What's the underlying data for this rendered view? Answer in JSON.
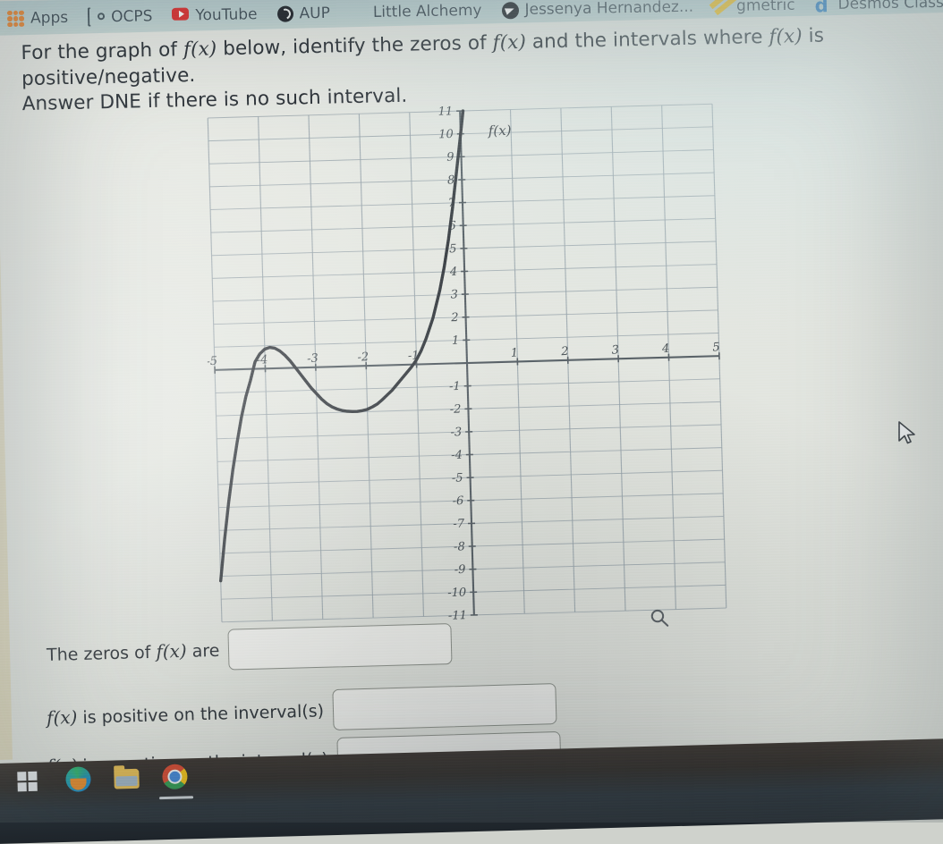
{
  "browser": {
    "bookmarks": [
      {
        "label": "Apps",
        "icon": "apps-grid-icon"
      },
      {
        "label": "OCPS",
        "icon": "gear-icon"
      },
      {
        "label": "YouTube",
        "icon": "youtube-icon"
      },
      {
        "label": "AUP",
        "icon": "globe-icon"
      },
      {
        "label": "Little Alchemy",
        "icon": "alchemy-flask-icon"
      },
      {
        "label": "Jessenya Hernandez...",
        "icon": "paper-plane-icon"
      },
      {
        "label": "gmetric",
        "icon": "gmetric-icon"
      },
      {
        "label": "Desmos Class",
        "icon": "desmos-d-icon"
      }
    ]
  },
  "question": {
    "line1_a": "For the graph of ",
    "line1_fx1": "f(x)",
    "line1_b": " below, identify the zeros of ",
    "line1_fx2": "f(x)",
    "line1_c": " and the intervals where ",
    "line1_fx3": "f(x)",
    "line1_d": " is positive/negative.",
    "line2": "Answer DNE if there is no such interval."
  },
  "answers": {
    "row1_pre": "The zeros of ",
    "row1_fx": "f(x)",
    "row1_post": " are",
    "row1_value": "",
    "row2_fx": "f(x)",
    "row2_post": " is positive on the inverval(s)",
    "row2_value": "",
    "row3_fx": "f(x)",
    "row3_post": " is negative on the interval(s)",
    "row3_value": ""
  },
  "taskbar": {
    "items": [
      {
        "name": "start-button",
        "icon": "windows-logo-icon"
      },
      {
        "name": "edge-button",
        "icon": "edge-icon"
      },
      {
        "name": "file-explorer-button",
        "icon": "folder-icon"
      },
      {
        "name": "chrome-button",
        "icon": "chrome-icon",
        "active": true
      }
    ]
  },
  "chart_data": {
    "type": "line",
    "title": "",
    "xlabel": "",
    "ylabel": "",
    "curve_label": "f(x)",
    "xlim": [
      -5,
      5
    ],
    "ylim": [
      -11,
      11
    ],
    "grid": true,
    "x_ticks": [
      -5,
      -4,
      -3,
      -2,
      -1,
      1,
      2,
      3,
      4,
      5
    ],
    "y_ticks": [
      -11,
      -10,
      -9,
      -8,
      -7,
      -6,
      -5,
      -4,
      -3,
      -2,
      -1,
      1,
      2,
      3,
      4,
      5,
      6,
      7,
      8,
      9,
      10,
      11
    ],
    "x_tick_labels": [
      "-5",
      "-4",
      "-3",
      "-2",
      "-1",
      "1",
      "2",
      "3",
      "4",
      "5"
    ],
    "y_tick_labels": [
      "-11",
      "-10",
      "-9",
      "-8",
      "-7",
      "-6",
      "-5",
      "-4",
      "-3",
      "-2",
      "-1",
      "1",
      "2",
      "3",
      "4",
      "5",
      "6",
      "7",
      "8",
      "9",
      "10",
      "11"
    ],
    "zeros": [
      -3.4,
      -0.65
    ],
    "local_max": [
      -4.2,
      0.9
    ],
    "local_min": [
      -2.2,
      -1.9
    ],
    "series": [
      {
        "name": "f(x)",
        "points": [
          [
            -5.0,
            -9.2
          ],
          [
            -4.9,
            -7.4
          ],
          [
            -4.8,
            -5.8
          ],
          [
            -4.7,
            -4.4
          ],
          [
            -4.6,
            -3.2
          ],
          [
            -4.5,
            -2.1
          ],
          [
            -4.4,
            -1.2
          ],
          [
            -4.3,
            -0.5
          ],
          [
            -4.2,
            0.3
          ],
          [
            -4.1,
            0.65
          ],
          [
            -4.0,
            0.85
          ],
          [
            -3.9,
            0.92
          ],
          [
            -3.8,
            0.88
          ],
          [
            -3.7,
            0.75
          ],
          [
            -3.6,
            0.55
          ],
          [
            -3.5,
            0.3
          ],
          [
            -3.4,
            0.0
          ],
          [
            -3.3,
            -0.3
          ],
          [
            -3.2,
            -0.6
          ],
          [
            -3.1,
            -0.9
          ],
          [
            -3.0,
            -1.15
          ],
          [
            -2.9,
            -1.4
          ],
          [
            -2.8,
            -1.6
          ],
          [
            -2.7,
            -1.75
          ],
          [
            -2.6,
            -1.85
          ],
          [
            -2.5,
            -1.92
          ],
          [
            -2.4,
            -1.96
          ],
          [
            -2.3,
            -1.98
          ],
          [
            -2.2,
            -1.98
          ],
          [
            -2.1,
            -1.95
          ],
          [
            -2.0,
            -1.9
          ],
          [
            -1.9,
            -1.8
          ],
          [
            -1.8,
            -1.68
          ],
          [
            -1.7,
            -1.5
          ],
          [
            -1.6,
            -1.3
          ],
          [
            -1.5,
            -1.1
          ],
          [
            -1.4,
            -0.85
          ],
          [
            -1.3,
            -0.6
          ],
          [
            -1.2,
            -0.35
          ],
          [
            -1.1,
            -0.1
          ],
          [
            -1.0,
            0.2
          ],
          [
            -0.9,
            0.6
          ],
          [
            -0.8,
            1.1
          ],
          [
            -0.7,
            1.7
          ],
          [
            -0.65,
            2.0
          ],
          [
            -0.6,
            2.4
          ],
          [
            -0.5,
            3.2
          ],
          [
            -0.4,
            4.2
          ],
          [
            -0.3,
            5.4
          ],
          [
            -0.2,
            6.8
          ],
          [
            -0.1,
            8.4
          ],
          [
            0.0,
            10.0
          ],
          [
            0.06,
            11.0
          ]
        ]
      }
    ],
    "note": "Curve crosses x-axis near x=-3.4 (sign change + to -) and near x=-0.65 (- to +); rises off the top of the grid just right of x=0"
  },
  "ui": {
    "magnifier_icon": "magnifying-glass-icon",
    "cursor_icon": "mouse-arrow-cursor"
  }
}
